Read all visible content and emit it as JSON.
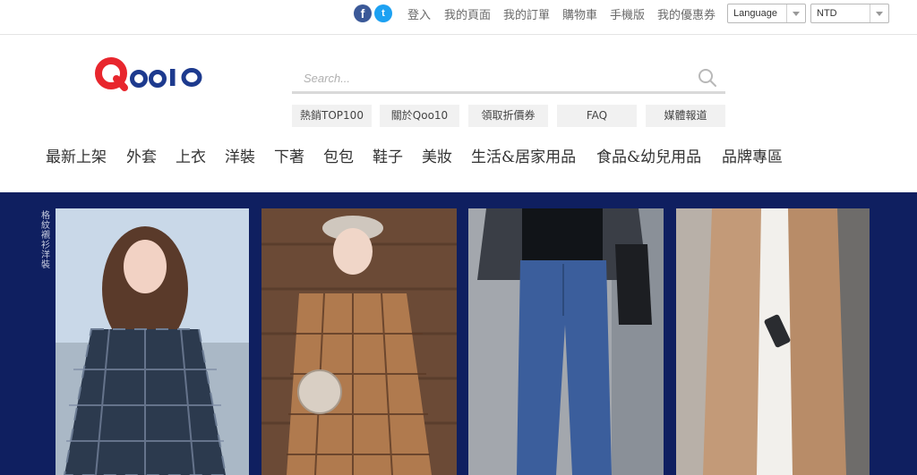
{
  "topbar": {
    "social": {
      "facebook_glyph": "f",
      "twitter_glyph": "t"
    },
    "links": [
      "登入",
      "我的頁面",
      "我的訂單",
      "購物車",
      "手機版",
      "我的優惠券"
    ],
    "language_select": "Language",
    "currency_select": "NTD"
  },
  "logo": {
    "text": "Qoo10",
    "color": "#e8262d"
  },
  "search": {
    "placeholder": "Search..."
  },
  "quick_links": [
    "熱銷TOP100",
    "關於Qoo10",
    "領取折價券",
    "FAQ",
    "媒體報道"
  ],
  "categories": [
    "最新上架",
    "外套",
    "上衣",
    "洋裝",
    "下著",
    "包包",
    "鞋子",
    "美妝",
    "生活&居家用品",
    "食品&幼兒用品",
    "品牌專區"
  ],
  "banner": {
    "background": "#0f1f60",
    "vertical_text": "格紋襯衫洋裝",
    "photos": [
      {
        "alt": "plaid-shirt-dress-model"
      },
      {
        "alt": "plaid-dress-beret-model"
      },
      {
        "alt": "blue-jeans-model"
      },
      {
        "alt": "camel-vest-model"
      }
    ]
  }
}
